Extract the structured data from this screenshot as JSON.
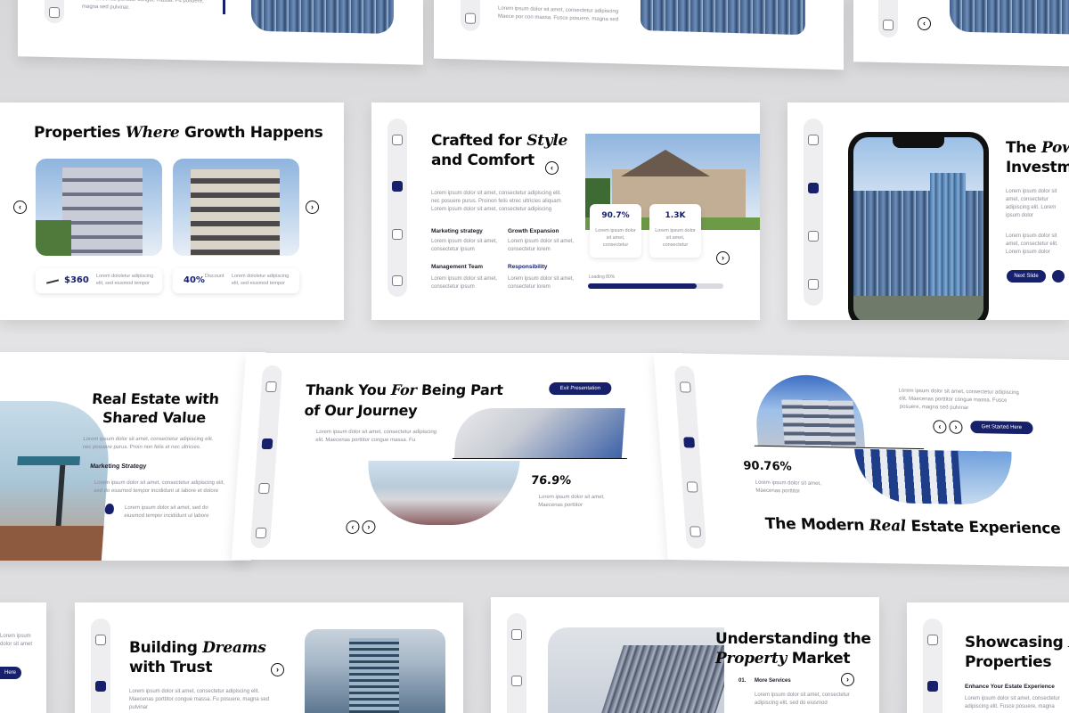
{
  "lorem_short": "Lorem ipsum dolor sit amet, consectetur adipiscing elit.",
  "lorem_line": "Lorem ipsum dolor sit amet, consectetur adipiscing elit. Maecenas porttitor congue massa. Fusce posuere, magna sed pulvinar",
  "lorem_two": "Lorem ipsum dolor sit amet, Maecenas porttitor",
  "top_row": {
    "a_text": "elit. Maecenas porttitor congue massa. Fu posuere, magna sed pulvinar.",
    "b_text": "Lorem ipsum dolor sit amet, consectetur adipiscing Maece por con massa. Fusce posuere, magna sed"
  },
  "growth": {
    "title_pre": "Properties",
    "title_em": "Where",
    "title_post": "Growth Happens",
    "price": "$360",
    "price_desc": "Lorem dololetur adipiscing elit, sed eiusmod tempor",
    "percent": "40%",
    "percent_label": "Discount",
    "percent_desc": "Lorem dololetur adipiscing elit, sed eiusmod tempor"
  },
  "crafted": {
    "title_l1": "Crafted for",
    "title_em": "Style",
    "title_l2": "and Comfort",
    "intro": "Lorem ipsum dolor sit amet, consectetur adipiscing elit. nec posuere purus. Proinon felis etrec ultricies aliquam Lorem ipsum dolor sit amet, consectetur adipiscing",
    "items": [
      {
        "label": "Marketing strategy",
        "text": "Lorem ipsum dolor sit amet, consectetur ipsum"
      },
      {
        "label": "Growth Expansion",
        "text": "Lorem ipsum dolor sit amet, consectetur lorem"
      },
      {
        "label": "Management Team",
        "text": "Lorem ipsum dolor sit amet, consectetur ipsum"
      },
      {
        "label": "Responsibility",
        "text": "Lorem ipsum dolor sit amet, consectetur lorem"
      }
    ],
    "stat1": "90.7%",
    "stat1_text": "Lorem ipsum dolor sit amet, consectetur",
    "stat2": "1.3K",
    "stat2_text": "Lorem ipsum dolor sit amet, consectetur",
    "loading_label": "Loading 80%",
    "loading_value": 0.8
  },
  "power": {
    "title_l1": "The",
    "title_em": "Pow",
    "title_l2": "Investme",
    "text1": "Lorem ipsum dolor sit amet, consectetur adipiscing elit. Lorem ipsum dolor",
    "text2": "Lorem ipsum dolor sit amet, consectetur elit. Lorem ipsum dolor",
    "next": "Next Slide"
  },
  "shared": {
    "title_l1": "Real Estate with",
    "title_l2": "Shared Value",
    "intro": "Lorem ipsum dolor sit amet, consectetur adipiscing elit. nec posuere purus. Proin non felis et nec ultricies.",
    "subhead": "Marketing Strategy",
    "text": "Lorem ipsum dolor sit amet, consectetur adipiscing elit, sed do eiusmod tempor incididunt ut labore et dolore",
    "bullet": "Lorem ipsum dolor sit amet, sed do eiusmod tempor incididunt ut labore"
  },
  "thanks": {
    "title_a": "Thank You",
    "title_em": "For",
    "title_b": "Being Part",
    "title_l2": "of Our Journey",
    "exit": "Exit Presentation",
    "intro": "Lorem ipsum dolor sit amet, consectetur adipiscing elit. Maecenas porttitor congue massa. Fu",
    "stat": "76.9%",
    "stat_text": "Lorem ipsum dolor sit amet, Maecenas porttitor"
  },
  "modern": {
    "intro": "Lorem ipsum dolor sit amet, consectetur adipiscing elit. Maecenas porttitor congue massa. Fusce posuere, magna sed pulvinar",
    "cta": "Get Started Here",
    "stat": "90.76%",
    "stat_text": "Lorem ipsum dolor sit amet, Maecenas porttitor",
    "title_a": "The Modern",
    "title_em": "Real",
    "title_b": "Estate Experience"
  },
  "bottom_row": {
    "left_text": "Lorem ipsum dolor sit amet",
    "left_btn": "Here",
    "dreams_l1": "Building",
    "dreams_em": "Dreams",
    "dreams_l2": "with Trust",
    "dreams_text": "Lorem ipsum dolor sit amet, consectetur adipiscing elit. Maecenas porttitor congue massa. Fu posuere, magna sed pulvinar",
    "understand_l1": "Understanding the",
    "understand_em": "Property",
    "understand_l2": "Market",
    "service_num": "01.",
    "service_label": "More Services",
    "service_text": "Lorem ipsum dolor sit amet, consectetur adipiscing elit, sed do eiusmod",
    "show_l1": "Showcasing",
    "show_em": "E",
    "show_l2": "Properties",
    "show_sub": "Enhance Your Estate Experience",
    "show_text": "Lorem ipsum dolor sit amet, consectetur adipiscing elit. Fusce posuere, magna"
  }
}
